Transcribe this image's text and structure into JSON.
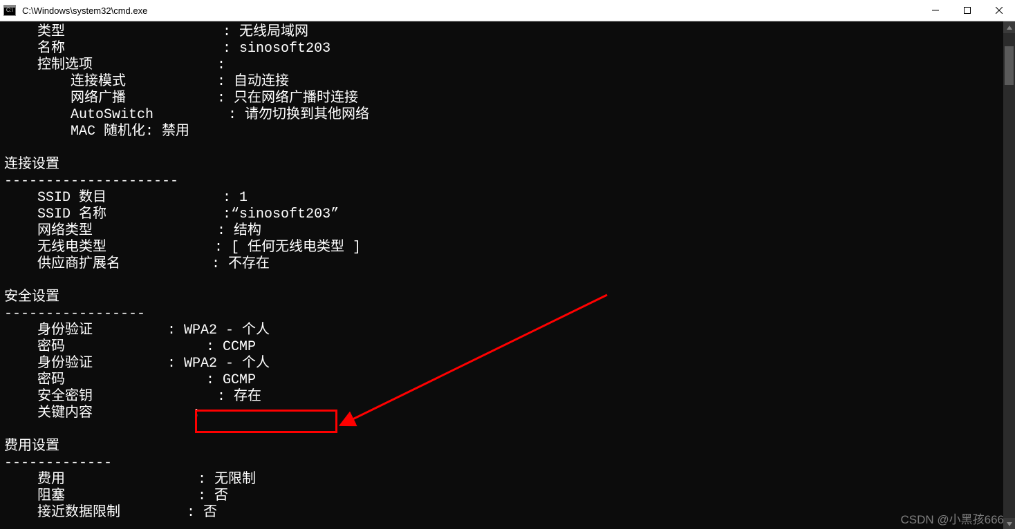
{
  "window": {
    "title": "C:\\Windows\\system32\\cmd.exe",
    "icon_label": "C:\\"
  },
  "terminal_output": "    类型                   : 无线局域网\n    名称                   : sinosoft203\n    控制选项               :\n        连接模式           : 自动连接\n        网络广播           : 只在网络广播时连接\n        AutoSwitch         : 请勿切换到其他网络\n        MAC 随机化: 禁用\n\n连接设置\n---------------------\n    SSID 数目              : 1\n    SSID 名称              :“sinosoft203”\n    网络类型               : 结构\n    无线电类型             : [ 任何无线电类型 ]\n    供应商扩展名           : 不存在\n\n安全设置\n-----------------\n    身份验证         : WPA2 - 个人\n    密码                 : CCMP\n    身份验证         : WPA2 - 个人\n    密码                 : GCMP\n    安全密钥               : 存在\n    关键内容            :\n\n费用设置\n-------------\n    费用                : 无限制\n    阻塞                : 否\n    接近数据限制        : 否",
  "annotation": {
    "highlight_target": "关键内容",
    "arrow_color": "#ff0000"
  },
  "watermark": "CSDN @小黑孩666"
}
